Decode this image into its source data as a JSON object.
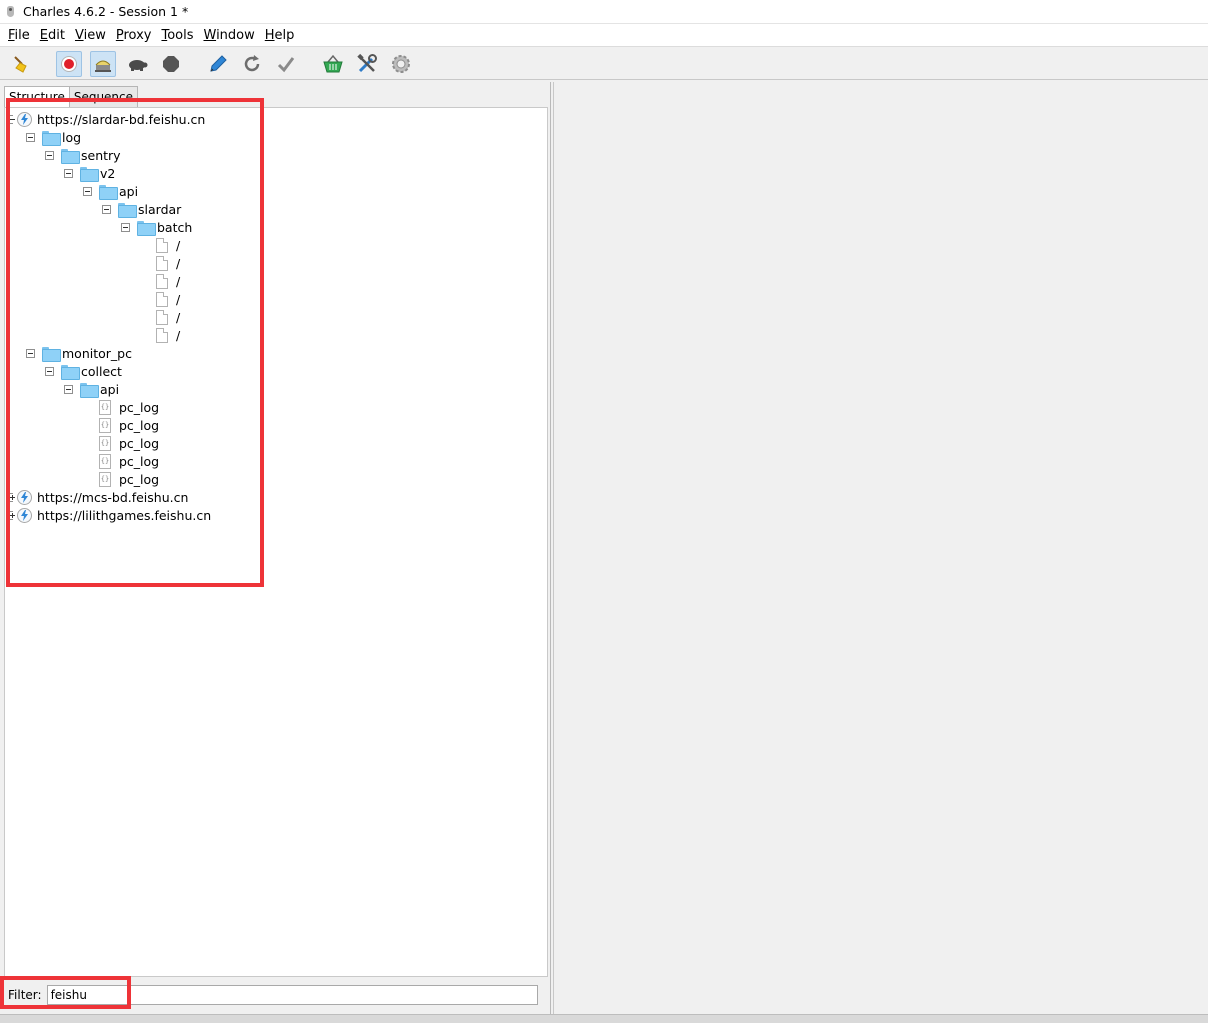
{
  "window": {
    "title": "Charles 4.6.2 - Session 1 *"
  },
  "menu": [
    {
      "label_mnemonic": "F",
      "label_rest": "ile"
    },
    {
      "label_mnemonic": "E",
      "label_rest": "dit"
    },
    {
      "label_mnemonic": "V",
      "label_rest": "iew"
    },
    {
      "label_mnemonic": "P",
      "label_rest": "roxy"
    },
    {
      "label_mnemonic": "T",
      "label_rest": "ools"
    },
    {
      "label_mnemonic": "W",
      "label_rest": "indow"
    },
    {
      "label_mnemonic": "H",
      "label_rest": "elp"
    }
  ],
  "toolbar": {
    "icons": [
      "broom-icon",
      "record-icon",
      "throttle-icon",
      "turtle-icon",
      "stop-icon",
      "pen-icon",
      "refresh-icon",
      "check-icon",
      "basket-icon",
      "tools-icon",
      "settings-icon"
    ],
    "active": [
      "record-icon",
      "throttle-icon"
    ],
    "colors": {
      "record": "#e0202a",
      "basket": "#33a853",
      "tools": "#2f7cc8",
      "pen": "#2f86d6"
    }
  },
  "tabs": [
    {
      "label": "Structure",
      "selected": true
    },
    {
      "label": "Sequence",
      "selected": false
    }
  ],
  "tree": {
    "nodes": [
      {
        "label": "https://slardar-bd.feishu.cn",
        "type": "host",
        "expanded": true
      },
      {
        "label": "log",
        "type": "folder"
      },
      {
        "label": "sentry",
        "type": "folder"
      },
      {
        "label": "v2",
        "type": "folder"
      },
      {
        "label": "api",
        "type": "folder"
      },
      {
        "label": "slardar",
        "type": "folder"
      },
      {
        "label": "batch",
        "type": "folder"
      },
      {
        "label": "/",
        "type": "file"
      },
      {
        "label": "/",
        "type": "file"
      },
      {
        "label": "/",
        "type": "file"
      },
      {
        "label": "/",
        "type": "file"
      },
      {
        "label": "/",
        "type": "file"
      },
      {
        "label": "/",
        "type": "file"
      },
      {
        "label": "monitor_pc",
        "type": "folder"
      },
      {
        "label": "collect",
        "type": "folder"
      },
      {
        "label": "api",
        "type": "folder"
      },
      {
        "label": "pc_log",
        "type": "json"
      },
      {
        "label": "pc_log",
        "type": "json"
      },
      {
        "label": "pc_log",
        "type": "json"
      },
      {
        "label": "pc_log",
        "type": "json"
      },
      {
        "label": "pc_log",
        "type": "json"
      },
      {
        "label": "https://mcs-bd.feishu.cn",
        "type": "host",
        "expanded": false
      },
      {
        "label": "https://lilithgames.feishu.cn",
        "type": "host",
        "expanded": false
      }
    ]
  },
  "filter": {
    "label": "Filter:",
    "value": "feishu"
  },
  "annotation_color": "#ee3338"
}
